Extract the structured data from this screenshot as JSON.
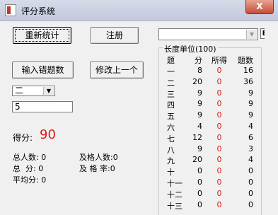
{
  "window": {
    "title": "评分系统",
    "close_glyph": "X"
  },
  "buttons": {
    "recount": "重新统计",
    "register": "注册",
    "input_wrong": "输入错题数",
    "modify_prev": "修改上一个",
    "e": "E"
  },
  "question_select": {
    "value": "二"
  },
  "count_input": {
    "value": "5"
  },
  "score": {
    "label": "得分:",
    "value": "90"
  },
  "stats": {
    "total_people": "总人数: 0",
    "pass_people": "及格人数:0",
    "total_score": "总  分: 0",
    "pass_rate": "及 格 率:0",
    "average": "平均分: 0"
  },
  "table": {
    "caption": "长度单位(100)",
    "headers": [
      "题",
      "分",
      "所得",
      "题数"
    ],
    "rows": [
      [
        "一",
        "8",
        "0",
        "16"
      ],
      [
        "二",
        "20",
        "0",
        "36"
      ],
      [
        "三",
        "9",
        "0",
        "9"
      ],
      [
        "四",
        "9",
        "0",
        "9"
      ],
      [
        "五",
        "9",
        "0",
        "9"
      ],
      [
        "六",
        "4",
        "0",
        "4"
      ],
      [
        "七",
        "12",
        "0",
        "6"
      ],
      [
        "八",
        "9",
        "0",
        "3"
      ],
      [
        "九",
        "20",
        "0",
        "4"
      ],
      [
        "十",
        "0",
        "0",
        "0"
      ],
      [
        "十一",
        "0",
        "0",
        "0"
      ],
      [
        "十二",
        "0",
        "0",
        "0"
      ],
      [
        "十三",
        "0",
        "0",
        "0"
      ]
    ]
  },
  "colors": {
    "accent_red": "#d81b1b"
  }
}
